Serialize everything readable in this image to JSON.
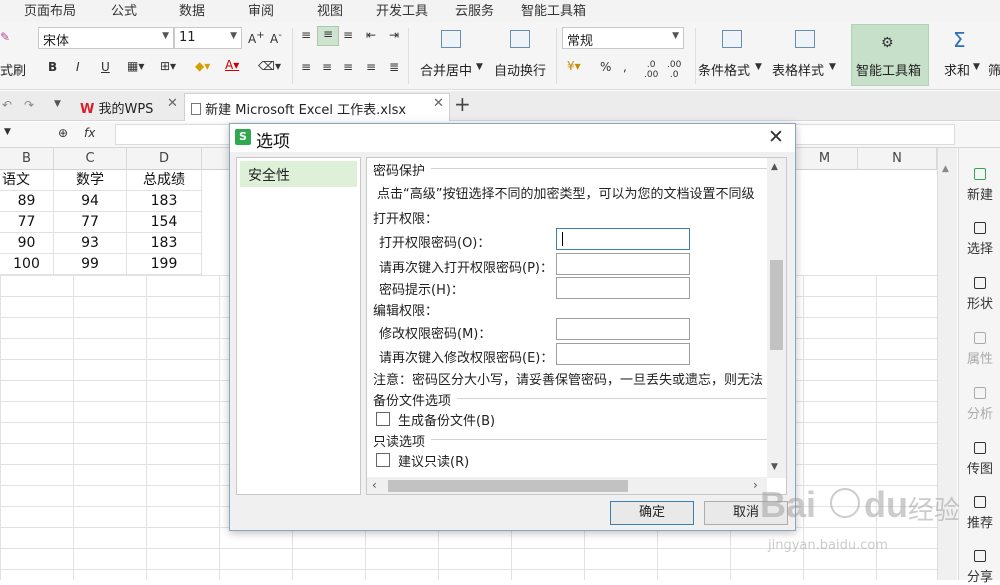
{
  "menu": [
    "页面布局",
    "公式",
    "数据",
    "审阅",
    "视图",
    "开发工具",
    "云服务",
    "智能工具箱"
  ],
  "ribbon": {
    "format_painter": "式刷",
    "font_name": "宋体",
    "font_size": "11",
    "merge_center": "合并居中",
    "wrap_text": "自动换行",
    "number_format": "常规",
    "conditional_format": "条件格式",
    "table_style": "表格样式",
    "smart_toolbox": "智能工具箱",
    "sum": "求和",
    "filter": "筛"
  },
  "tabs": {
    "wps_home": "我的WPS",
    "document": "新建 Microsoft Excel 工作表.xlsx",
    "add": "+"
  },
  "formula_bar": {
    "fx": "fx"
  },
  "grid": {
    "columns": [
      "B",
      "C",
      "D",
      "",
      "",
      "",
      "",
      "",
      "",
      "",
      "",
      "",
      "M",
      "N"
    ],
    "rows": [
      [
        "语文",
        "数学",
        "总成绩"
      ],
      [
        "89",
        "94",
        "183"
      ],
      [
        "77",
        "77",
        "154"
      ],
      [
        "90",
        "93",
        "183"
      ],
      [
        "100",
        "99",
        "199"
      ]
    ]
  },
  "right_pane": [
    {
      "label": "新建",
      "enabled": true
    },
    {
      "label": "选择",
      "enabled": true
    },
    {
      "label": "形状",
      "enabled": true
    },
    {
      "label": "属性",
      "enabled": false
    },
    {
      "label": "分析",
      "enabled": false
    },
    {
      "label": "传图",
      "enabled": true
    },
    {
      "label": "推荐",
      "enabled": true
    },
    {
      "label": "分享",
      "enabled": true
    }
  ],
  "dialog": {
    "title": "选项",
    "close": "✕",
    "nav_selected": "安全性",
    "password_protection": "密码保护",
    "advanced_hint": "点击“高级”按钮选择不同的加密类型，可以为您的文档设置不同级",
    "open_permission": "打开权限：",
    "open_password_label": "打开权限密码(O)：",
    "open_password_confirm_label": "请再次键入打开权限密码(P)：",
    "password_hint_label": "密码提示(H)：",
    "edit_permission": "编辑权限：",
    "modify_password_label": "修改权限密码(M)：",
    "modify_password_confirm_label": "请再次键入修改权限密码(E)：",
    "note": "注意：密码区分大小写，请妥善保管密码，一旦丢失或遗忘，则无法",
    "backup_options": "备份文件选项",
    "generate_backup": "生成备份文件(B)",
    "readonly_options": "只读选项",
    "suggest_readonly": "建议只读(R)",
    "ok": "确定",
    "cancel": "取消"
  },
  "watermark": {
    "brand": "Bai",
    "brand2": "du",
    "cn": "经验",
    "url": "jingyan.baidu.com"
  },
  "colors": {
    "accent_green": "#2fa84f",
    "selected_nav": "#dff0d8",
    "focus_border": "#3c7fb1"
  }
}
